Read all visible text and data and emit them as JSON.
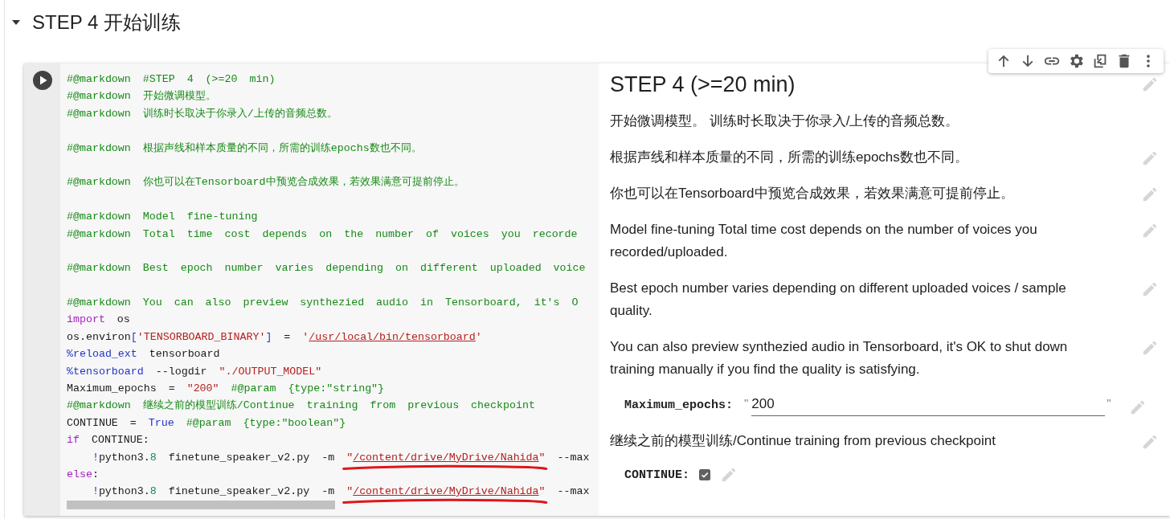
{
  "section": {
    "title": "STEP 4 开始训练",
    "expanded": true
  },
  "code": {
    "lines": [
      {
        "kind": "code",
        "tokens": [
          {
            "kind": "comment",
            "text": "#@markdown #STEP 4 (>=20 min)"
          }
        ]
      },
      {
        "kind": "code",
        "tokens": [
          {
            "kind": "comment",
            "text": "#@markdown 开始微调模型。"
          }
        ]
      },
      {
        "kind": "code",
        "tokens": [
          {
            "kind": "comment",
            "text": "#@markdown 训练时长取决于你录入/上传的音频总数。"
          }
        ]
      },
      {
        "kind": "blank"
      },
      {
        "kind": "code",
        "tokens": [
          {
            "kind": "comment",
            "text": "#@markdown 根据声线和样本质量的不同，所需的训练epochs数也不同。"
          }
        ]
      },
      {
        "kind": "blank"
      },
      {
        "kind": "code",
        "tokens": [
          {
            "kind": "comment",
            "text": "#@markdown 你也可以在Tensorboard中预览合成效果，若效果满意可提前停止。"
          }
        ]
      },
      {
        "kind": "blank"
      },
      {
        "kind": "code",
        "tokens": [
          {
            "kind": "comment",
            "text": "#@markdown Model fine-tuning"
          }
        ]
      },
      {
        "kind": "code",
        "tokens": [
          {
            "kind": "comment",
            "text": "#@markdown Total time cost depends on the number of voices you recorde"
          }
        ]
      },
      {
        "kind": "blank"
      },
      {
        "kind": "code",
        "tokens": [
          {
            "kind": "comment",
            "text": "#@markdown Best epoch number varies depending on different uploaded voice"
          }
        ]
      },
      {
        "kind": "blank"
      },
      {
        "kind": "code",
        "tokens": [
          {
            "kind": "comment",
            "text": "#@markdown You can also preview synthezied audio in Tensorboard, it's O"
          }
        ]
      },
      {
        "kind": "code",
        "tokens": [
          {
            "kind": "keyword",
            "text": "import"
          },
          {
            "kind": "plain",
            "text": " os"
          }
        ]
      },
      {
        "kind": "code",
        "tokens": [
          {
            "kind": "plain",
            "text": "os.environ"
          },
          {
            "kind": "magic",
            "text": "["
          },
          {
            "kind": "string",
            "text": "'TENSORBOARD_BINARY'"
          },
          {
            "kind": "magic",
            "text": "]"
          },
          {
            "kind": "plain",
            "text": " = "
          },
          {
            "kind": "string",
            "text": "'"
          },
          {
            "kind": "string",
            "text": "/usr/local/bin/tensorboard",
            "underlined": true
          },
          {
            "kind": "string",
            "text": "'"
          }
        ]
      },
      {
        "kind": "code",
        "tokens": [
          {
            "kind": "magic",
            "text": "%reload_ext"
          },
          {
            "kind": "plain",
            "text": " tensorboard"
          }
        ]
      },
      {
        "kind": "code",
        "tokens": [
          {
            "kind": "magic",
            "text": "%tensorboard"
          },
          {
            "kind": "plain",
            "text": " --logdir "
          },
          {
            "kind": "string",
            "text": "\"./OUTPUT_MODEL\""
          }
        ]
      },
      {
        "kind": "code",
        "tokens": [
          {
            "kind": "plain",
            "text": "Maximum_epochs = "
          },
          {
            "kind": "string",
            "text": "\"200\""
          },
          {
            "kind": "comment",
            "text": " #@param {type:\"string\"}"
          }
        ]
      },
      {
        "kind": "code",
        "tokens": [
          {
            "kind": "comment",
            "text": "#@markdown 继续之前的模型训练/Continue training from previous checkpoint"
          }
        ]
      },
      {
        "kind": "code",
        "tokens": [
          {
            "kind": "plain",
            "text": "CONTINUE = "
          },
          {
            "kind": "magic",
            "text": "True"
          },
          {
            "kind": "comment",
            "text": " #@param {type:\"boolean\"}"
          }
        ]
      },
      {
        "kind": "code",
        "tokens": [
          {
            "kind": "keyword",
            "text": "if"
          },
          {
            "kind": "plain",
            "text": " CONTINUE:"
          }
        ]
      },
      {
        "kind": "code",
        "indented": true,
        "tokens": [
          {
            "kind": "magic",
            "text": "!"
          },
          {
            "kind": "plain",
            "text": "python3."
          },
          {
            "kind": "number",
            "text": "8"
          },
          {
            "kind": "plain",
            "text": " finetune_speaker_v2.py -m "
          },
          {
            "kind": "string",
            "text": "\""
          },
          {
            "kind": "string",
            "text": "/content/drive/MyDrive/Nahida",
            "underlined": true,
            "annotated": true
          },
          {
            "kind": "string",
            "text": "\""
          },
          {
            "kind": "plain",
            "text": " --max"
          }
        ]
      },
      {
        "kind": "code",
        "tokens": [
          {
            "kind": "keyword",
            "text": "else"
          },
          {
            "kind": "plain",
            "text": ":"
          }
        ]
      },
      {
        "kind": "code",
        "indented": true,
        "tokens": [
          {
            "kind": "magic",
            "text": "!"
          },
          {
            "kind": "plain",
            "text": "python3."
          },
          {
            "kind": "number",
            "text": "8"
          },
          {
            "kind": "plain",
            "text": " finetune_speaker_v2.py -m "
          },
          {
            "kind": "string",
            "text": "\""
          },
          {
            "kind": "string",
            "text": "/content/drive/MyDrive/Nahida",
            "underlined": true,
            "annotated": true
          },
          {
            "kind": "string",
            "text": "\""
          },
          {
            "kind": "plain",
            "text": " --max"
          }
        ]
      }
    ]
  },
  "form": {
    "items": [
      {
        "kind": "heading",
        "text": "STEP 4 (>=20 min)",
        "edit_icon": true
      },
      {
        "kind": "text",
        "text": "开始微调模型。 训练时长取决于你录入/上传的音频总数。",
        "edit_icon": false
      },
      {
        "kind": "text",
        "text": "根据声线和样本质量的不同，所需的训练epochs数也不同。",
        "edit_icon": true
      },
      {
        "kind": "text",
        "text": "你也可以在Tensorboard中预览合成效果，若效果满意可提前停止。",
        "edit_icon": true
      },
      {
        "kind": "text",
        "text": "Model fine-tuning Total time cost depends on the number of voices you recorded/uploaded.",
        "edit_icon": true
      },
      {
        "kind": "text",
        "text": "Best epoch number varies depending on different uploaded voices / sample quality.",
        "edit_icon": true
      },
      {
        "kind": "text",
        "text": "You can also preview synthezied audio in Tensorboard, it's OK to shut down training manually if you find the quality is satisfying.",
        "edit_icon": true
      },
      {
        "kind": "field",
        "label": "Maximum_epochs:",
        "open_quote": "\"",
        "value": "200",
        "close_quote": "\"",
        "edit_icon": true
      },
      {
        "kind": "text",
        "text": "继续之前的模型训练/Continue training from previous checkpoint",
        "edit_icon": true
      },
      {
        "kind": "checkbox",
        "label": "CONTINUE:",
        "checked": true,
        "edit_icon": true
      }
    ]
  }
}
